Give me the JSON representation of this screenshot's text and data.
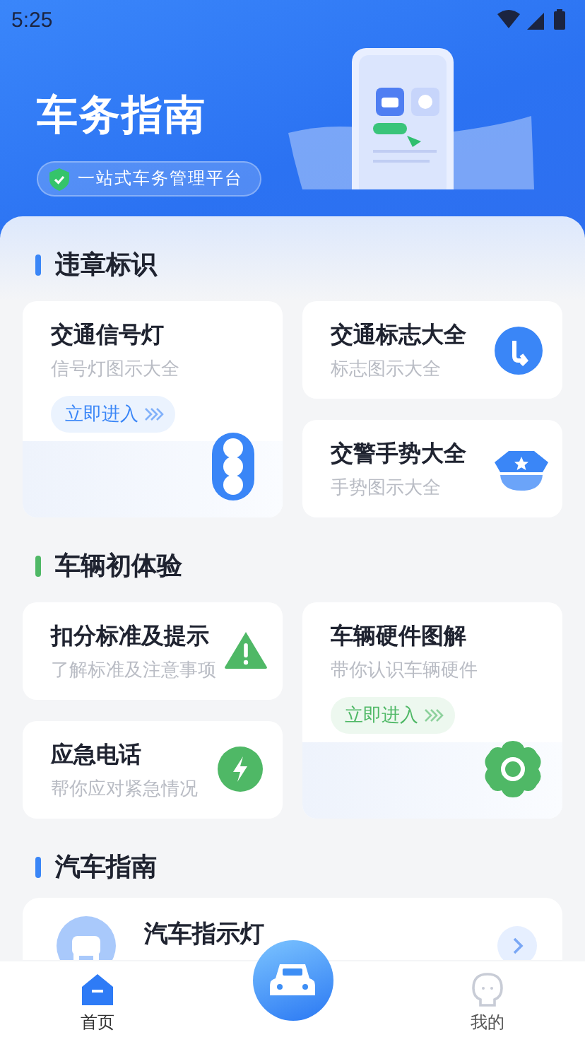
{
  "status_bar": {
    "time": "5:25"
  },
  "header": {
    "title": "车务指南",
    "tagline": "一站式车务管理平台"
  },
  "sections": [
    {
      "title": "违章标识",
      "color": "#3a86f7",
      "cards": [
        {
          "kind": "tall",
          "title": "交通信号灯",
          "subtitle": "信号灯图示大全",
          "enter_label": "立即进入"
        },
        {
          "kind": "small",
          "title": "交通标志大全",
          "subtitle": "标志图示大全"
        },
        {
          "kind": "small",
          "title": "交警手势大全",
          "subtitle": "手势图示大全"
        }
      ]
    },
    {
      "title": "车辆初体验",
      "color": "#4fb866",
      "cards": [
        {
          "kind": "small",
          "title": "扣分标准及提示",
          "subtitle": "了解标准及注意事项"
        },
        {
          "kind": "small",
          "title": "应急电话",
          "subtitle": "帮你应对紧急情况"
        },
        {
          "kind": "tall",
          "title": "车辆硬件图解",
          "subtitle": "带你认识车辆硬件",
          "enter_label": "立即进入"
        }
      ]
    },
    {
      "title": "汽车指南",
      "color": "#3a86f7",
      "list": [
        {
          "title": "汽车指示灯"
        }
      ]
    }
  ],
  "tabs": [
    {
      "kind": "home",
      "label": "首页",
      "selected": true
    },
    {
      "kind": "car",
      "selected": false
    },
    {
      "kind": "profile",
      "label": "我的",
      "selected": false
    }
  ]
}
